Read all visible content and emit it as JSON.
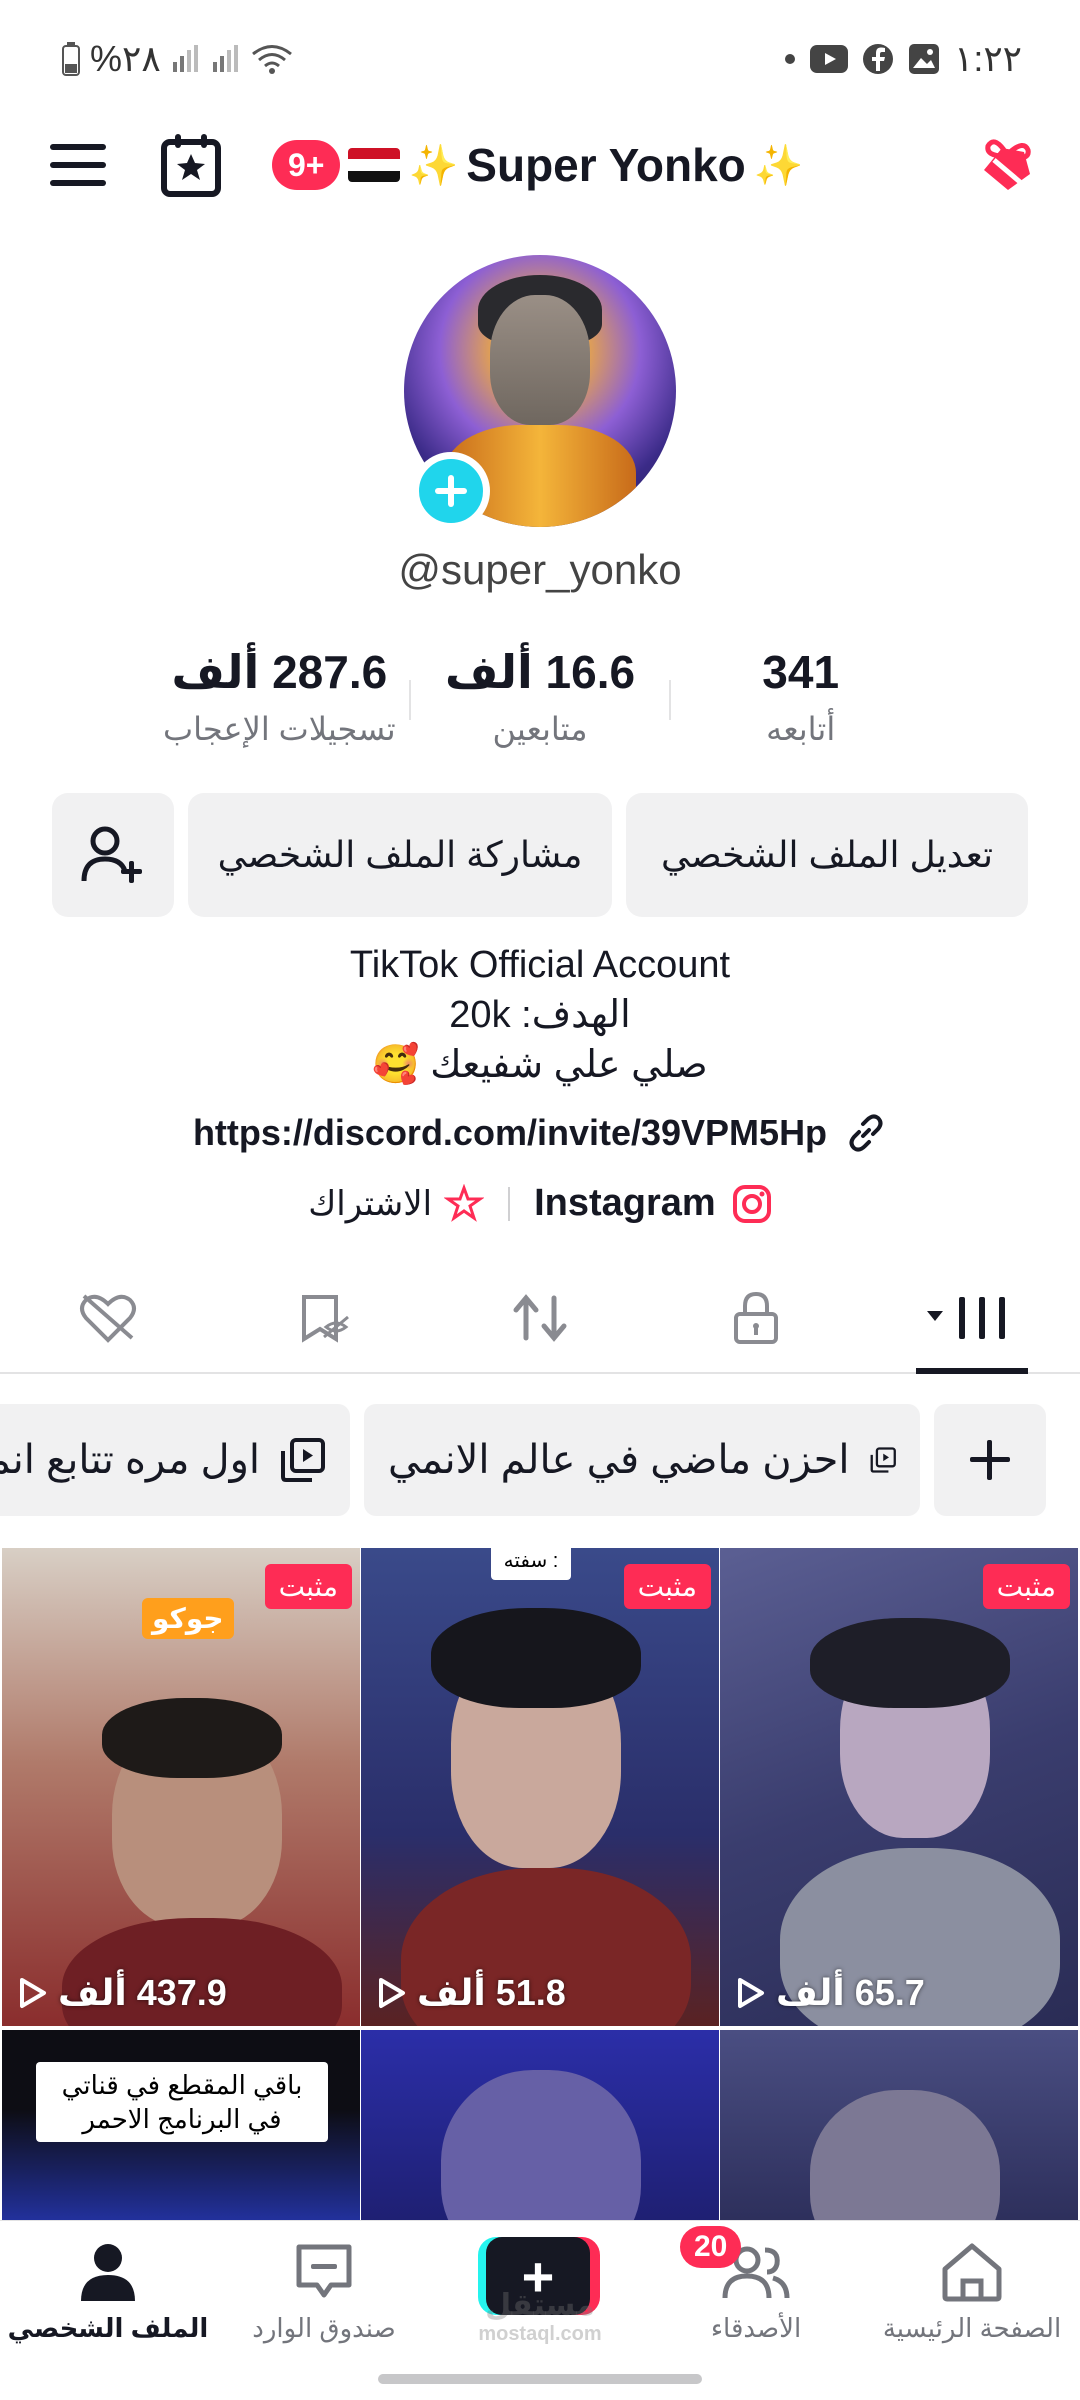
{
  "status_bar": {
    "time": "١:٢٢",
    "battery": "%٢٨"
  },
  "header": {
    "notification_badge": "9+",
    "title": "Super Yonko"
  },
  "profile": {
    "username": "@super_yonko",
    "stats": [
      {
        "value": "287.6 ألف",
        "label": "تسجيلات الإعجاب"
      },
      {
        "value": "16.6 ألف",
        "label": "متابعين"
      },
      {
        "value": "341",
        "label": "أتابعه"
      }
    ],
    "buttons": {
      "edit": "تعديل الملف الشخصي",
      "share": "مشاركة الملف الشخصي"
    },
    "bio": {
      "line1": "TikTok Official Account",
      "line2": "الهدف: 20k",
      "line3": "صلي علي شفيعك",
      "link": "https://discord.com/invite/39VPM5Hp"
    },
    "instagram": "Instagram",
    "subscription": "الاشتراك"
  },
  "playlists": [
    {
      "label": "احزن ماضي في عالم الانمي"
    },
    {
      "label": "اول مره تتابع انمي"
    }
  ],
  "videos": [
    {
      "views": "65.7 ألف",
      "pinned": "مثبت"
    },
    {
      "views": "51.8 ألف",
      "pinned": "مثبت",
      "top_text": "سفته :"
    },
    {
      "views": "437.9 ألف",
      "pinned": "مثبت",
      "sticker": "جوكو"
    },
    {
      "note": "باقي المقطع في قناتي في البرنامج الاحمر"
    }
  ],
  "bottom_nav": {
    "home": "الصفحة الرئيسية",
    "friends": "الأصدقاء",
    "friends_badge": "20",
    "inbox": "صندوق الوارد",
    "profile": "الملف الشخصي"
  },
  "watermark": {
    "main": "مستقل",
    "sub": "mostaql.com"
  },
  "colors": {
    "accent": "#fe2c55",
    "cyan": "#20d5ec",
    "text": "#161823",
    "secondary": "#73757c",
    "button_bg": "#f1f1f2"
  }
}
